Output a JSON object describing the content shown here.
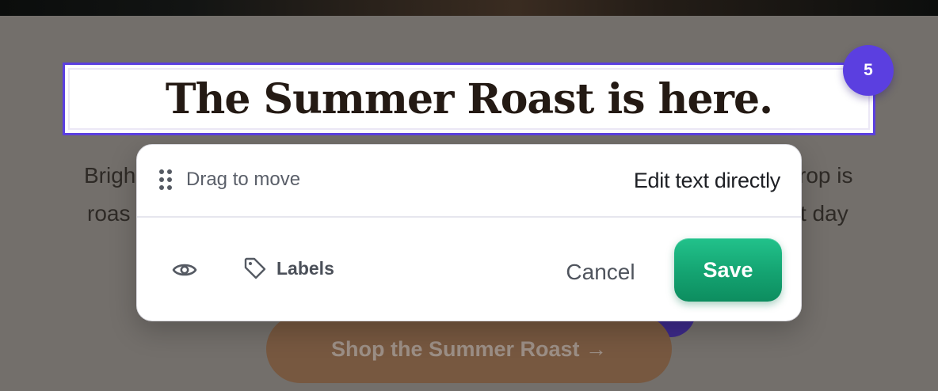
{
  "page": {
    "headline": "The Summer Roast is here.",
    "body_line1_left": "Brigh",
    "body_line1_right": "rop is",
    "body_line2_left": "roas",
    "body_line2_right": "t day",
    "cta_label": "Shop the Summer Roast →"
  },
  "editor": {
    "step_number": "5",
    "drag_label": "Drag to move",
    "mode_label": "Edit text directly",
    "labels_label": "Labels",
    "cancel_label": "Cancel",
    "save_label": "Save",
    "icons": {
      "drag": "grip-dots-icon",
      "visibility": "eye-icon",
      "labels": "tag-icon"
    }
  },
  "colors": {
    "accent": "#5b3fe0",
    "save": "#14a371",
    "overlay": "#736f6b",
    "cta": "#775840"
  }
}
